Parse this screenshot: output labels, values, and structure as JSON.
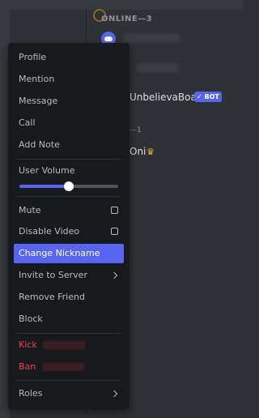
{
  "members": {
    "online_header": "ONLINE—3",
    "member_name": "UnbelievaBoat",
    "bot_tag": "✓ BOT",
    "section_count": "—1",
    "member_name_2": "Oni",
    "crown_icon": "crown"
  },
  "menu": {
    "profile": "Profile",
    "mention": "Mention",
    "message": "Message",
    "call": "Call",
    "add_note": "Add Note",
    "user_volume": "User Volume",
    "volume_level": 0.5,
    "mute": "Mute",
    "disable_video": "Disable Video",
    "change_nickname": "Change Nickname",
    "invite_to_server": "Invite to Server",
    "remove_friend": "Remove Friend",
    "block": "Block",
    "kick": "Kick",
    "ban": "Ban",
    "roles": "Roles"
  },
  "colors": {
    "accent": "#5865f2",
    "danger": "#ed4245",
    "menu_bg": "#18191c"
  }
}
